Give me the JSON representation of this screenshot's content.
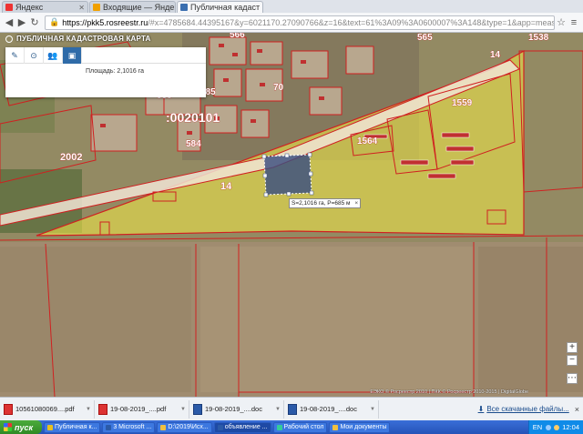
{
  "browser": {
    "tabs": [
      {
        "label": "Яндекс",
        "active": false,
        "favicon_color": "#e33"
      },
      {
        "label": "Входящие — Яндекс",
        "active": false,
        "favicon_color": "#f0a000"
      },
      {
        "label": "Публичная кадаст",
        "active": true,
        "favicon_color": "#3a6fb0"
      }
    ],
    "url_domain": "https://pkk5.rosreestr.ru",
    "url_path": "/#x=4785684.44395167&y=6021170.27090766&z=16&text=61%3A09%3A0600007%3A148&type=1&app=meas"
  },
  "app": {
    "title": "ПУБЛИЧНАЯ КАДАСТРОВАЯ КАРТА",
    "measurement_area": "Площадь: 2,1016 га",
    "selection_label": "S=2,1016 га, P=685 м",
    "selection_close": "×",
    "zoom_in": "+",
    "zoom_out": "−",
    "more": "⋯",
    "copyright": "ЕЭКО © Росреестр 2010 | ПКК © Росреестр 2010-2015 | DigitalGlobe"
  },
  "map_labels": {
    "quarter": ":0020101",
    "parcel_14_a": "14",
    "parcel_14_b": "14",
    "parcel_1564": "1564",
    "parcel_1559": "1559",
    "parcel_565": "565",
    "parcel_1538": "1538",
    "parcel_2002": "2002",
    "parcel_585": "585",
    "parcel_558": "558",
    "parcel_566": "566",
    "parcel_584": "584",
    "parcel_70": "70"
  },
  "downloads": [
    {
      "name": "10561080069....pdf",
      "type": "pdf"
    },
    {
      "name": "19-08-2019_....pdf",
      "type": "pdf"
    },
    {
      "name": "19-08-2019_....doc",
      "type": "doc"
    },
    {
      "name": "19-08-2019_....doc",
      "type": "doc"
    }
  ],
  "downloads_all": "Все скачанные файлы...",
  "downloads_close": "×",
  "taskbar": {
    "start": "пуск",
    "tasks": [
      {
        "label": "Публичная к...",
        "icon_color": "#e8c020",
        "active": false
      },
      {
        "label": "3 Microsoft ...",
        "icon_color": "#2b5aa8",
        "active": false
      },
      {
        "label": "D:\\2019\\Исх...",
        "icon_color": "#f0c040",
        "active": false
      },
      {
        "label": "объявление ...",
        "icon_color": "#2b5aa8",
        "active": true
      },
      {
        "label": "Рабочий стол",
        "icon_color": "#3c9",
        "active": false
      },
      {
        "label": "Мои документы",
        "icon_color": "#f0c040",
        "active": false
      }
    ],
    "lang": "EN",
    "clock": "12:04"
  },
  "colors": {
    "parcel_fill": "#e8e04a",
    "boundary": "#d02020",
    "selection": "#3a4e80"
  }
}
